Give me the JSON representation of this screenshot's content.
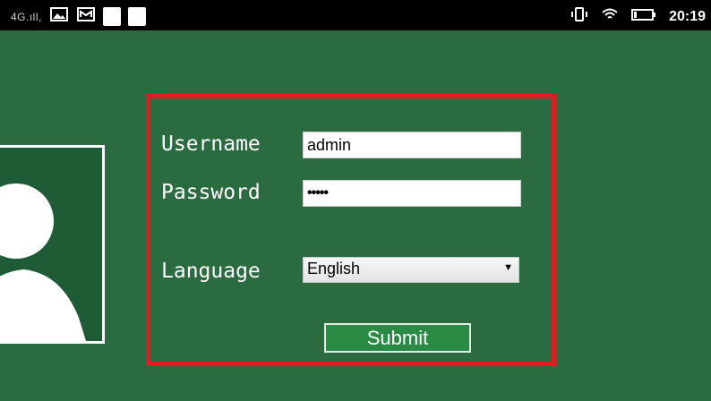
{
  "status_bar": {
    "signal_text": "4G.ıll,",
    "time": "20:19",
    "icons": [
      "image-icon",
      "mail-icon",
      "notification-square-icon",
      "notification-square-icon",
      "vibrate-icon",
      "wifi-icon",
      "battery-icon"
    ]
  },
  "login": {
    "username_label": "Username",
    "username_value": "admin",
    "password_label": "Password",
    "password_value": "•••••",
    "language_label": "Language",
    "language_selected": "English",
    "submit_label": "Submit"
  },
  "colors": {
    "background": "#2a6b40",
    "frame_border": "#e11b22",
    "submit_bg": "#2a8b44",
    "avatar_bg": "#1e5c35"
  }
}
